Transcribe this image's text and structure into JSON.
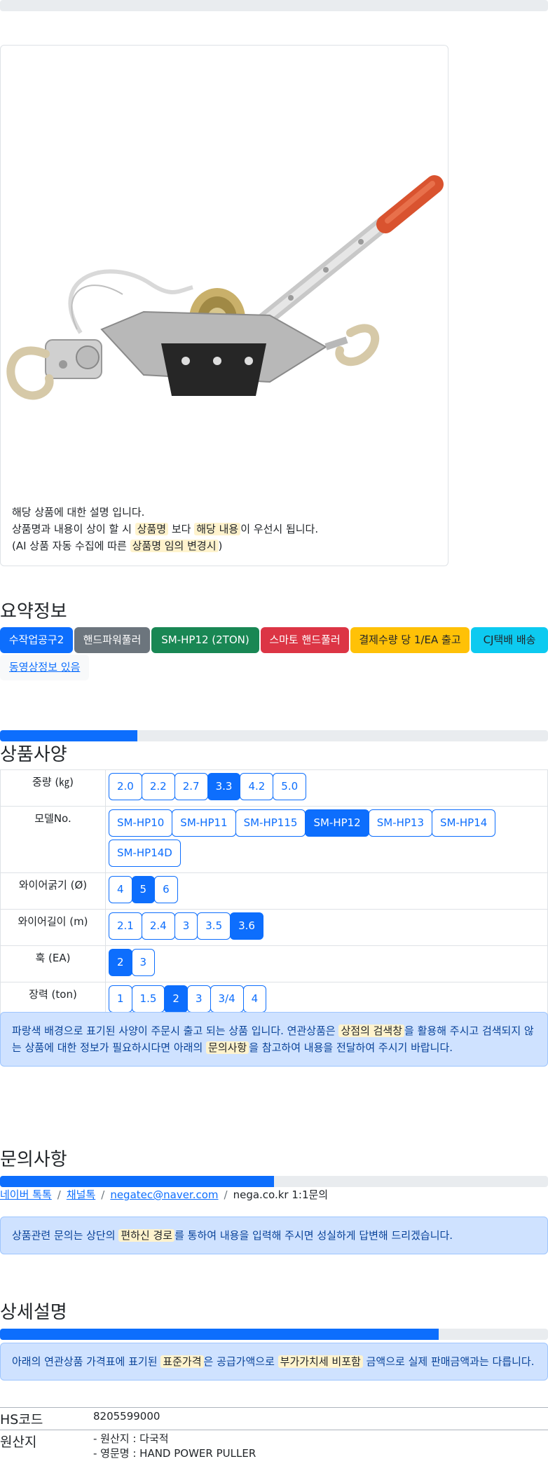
{
  "product": {
    "desc_line1": "해당 상품에 대한 설명 입니다.",
    "desc_line2_a": "상품명과 내용이 상이 할 시",
    "desc_line2_hl1": "상품명",
    "desc_line2_b": "보다",
    "desc_line2_hl2": "해당 내용",
    "desc_line2_c": "이 우선시 됩니다.",
    "desc_line3_a": "(AI 상품 자동 수집에 따른",
    "desc_line3_hl": "상품명 임의 변경시",
    "desc_line3_b": ")"
  },
  "summary": {
    "title": "요약정보",
    "badges": [
      {
        "label": "수작업공구2",
        "color": "#0d6efd",
        "text": "#ffffff"
      },
      {
        "label": "핸드파워풀러",
        "color": "#6c757d",
        "text": "#ffffff"
      },
      {
        "label": "SM-HP12 (2TON)",
        "color": "#198754",
        "text": "#ffffff"
      },
      {
        "label": "스마토 핸드풀러",
        "color": "#dc3545",
        "text": "#ffffff"
      },
      {
        "label": "결제수량 당 1/EA 출고",
        "color": "#ffc107",
        "text": "#212529"
      },
      {
        "label": "CJ택배 배송",
        "color": "#0dcaf0",
        "text": "#212529"
      }
    ],
    "video_link": "동영상정보 있음"
  },
  "spec": {
    "progress": 25,
    "title": "상품사양",
    "rows": [
      {
        "label": "중량 (㎏)",
        "options": [
          "2.0",
          "2.2",
          "2.7",
          "3.3",
          "4.2",
          "5.0"
        ],
        "selected": "3.3"
      },
      {
        "label": "모델No.",
        "options": [
          "SM-HP10",
          "SM-HP11",
          "SM-HP115",
          "SM-HP12",
          "SM-HP13",
          "SM-HP14",
          "SM-HP14D"
        ],
        "selected": "SM-HP12"
      },
      {
        "label": "와이어굵기 (Ø)",
        "options": [
          "4",
          "5",
          "6"
        ],
        "selected": "5"
      },
      {
        "label": "와이어길이 (m)",
        "options": [
          "2.1",
          "2.4",
          "3",
          "3.5",
          "3.6"
        ],
        "selected": "3.6"
      },
      {
        "label": "훅 (EA)",
        "options": [
          "2",
          "3"
        ],
        "selected": "2"
      },
      {
        "label": "장력 (ton)",
        "options": [
          "1",
          "1.5",
          "2",
          "3",
          "3/4",
          "4"
        ],
        "selected": "2"
      }
    ],
    "notice_a": "파랑색 배경으로 표기된 사양이 주문시 출고 되는 상품 입니다. 연관상품은",
    "notice_hl1": "상점의 검색창",
    "notice_b": "을 활용해 주시고 검색되지 않는 상품에 대한 정보가 필요하시다면 아래의",
    "notice_hl2": "문의사항",
    "notice_c": "을 참고하여 내용을 전달하여 주시기 바랍니다."
  },
  "inquiry": {
    "title": "문의사항",
    "progress": 50,
    "links": [
      "네이버 톡톡",
      "채널톡",
      "negatec@naver.com"
    ],
    "text_item": "nega.co.kr 1:1문의",
    "notice_a": "상품관련 문의는 상단의",
    "notice_hl": "편하신 경로",
    "notice_b": "를 통하여 내용을 입력해 주시면 성실하게 답변해 드리겠습니다."
  },
  "detail": {
    "title": "상세설명",
    "progress": 80,
    "notice_a": "아래의 연관상품 가격표에 표기된",
    "notice_hl1": "표준가격",
    "notice_b": "은 공급가액으로",
    "notice_hl2": "부가가치세 비포함",
    "notice_c": "금액으로 실제 판매금액과는 다릅니다.",
    "hs_label": "HS코드",
    "hs_value": "8205599000",
    "origin_label": "원산지",
    "origin_line1": "- 원산지 : 다국적",
    "origin_line2": "- 영문명 : HAND POWER PULLER"
  }
}
